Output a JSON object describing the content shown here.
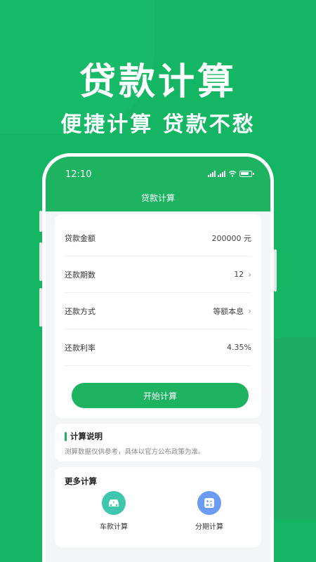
{
  "hero": {
    "title": "贷款计算",
    "subtitle": "便捷计算  贷款不愁"
  },
  "status_bar": {
    "time": "12:10"
  },
  "app": {
    "title": "贷款计算"
  },
  "form": {
    "rows": [
      {
        "label": "贷款金额",
        "value": "200000 元",
        "has_chevron": false
      },
      {
        "label": "还款期数",
        "value": "12",
        "has_chevron": true
      },
      {
        "label": "还款方式",
        "value": "等额本息",
        "has_chevron": true
      },
      {
        "label": "还款利率",
        "value": "4.35%",
        "has_chevron": false
      }
    ],
    "submit_label": "开始计算"
  },
  "info": {
    "title": "计算说明",
    "text": "测算数据仅供参考，具体以官方公布政策为准。"
  },
  "more": {
    "title": "更多计算",
    "items": [
      {
        "label": "车款计算",
        "icon": "car-loan-icon",
        "color": "#3ec7ad"
      },
      {
        "label": "分期计算",
        "icon": "calculator-icon",
        "color": "#6b9cf5"
      }
    ]
  },
  "colors": {
    "background": "#14b664",
    "accent": "#1db361"
  }
}
